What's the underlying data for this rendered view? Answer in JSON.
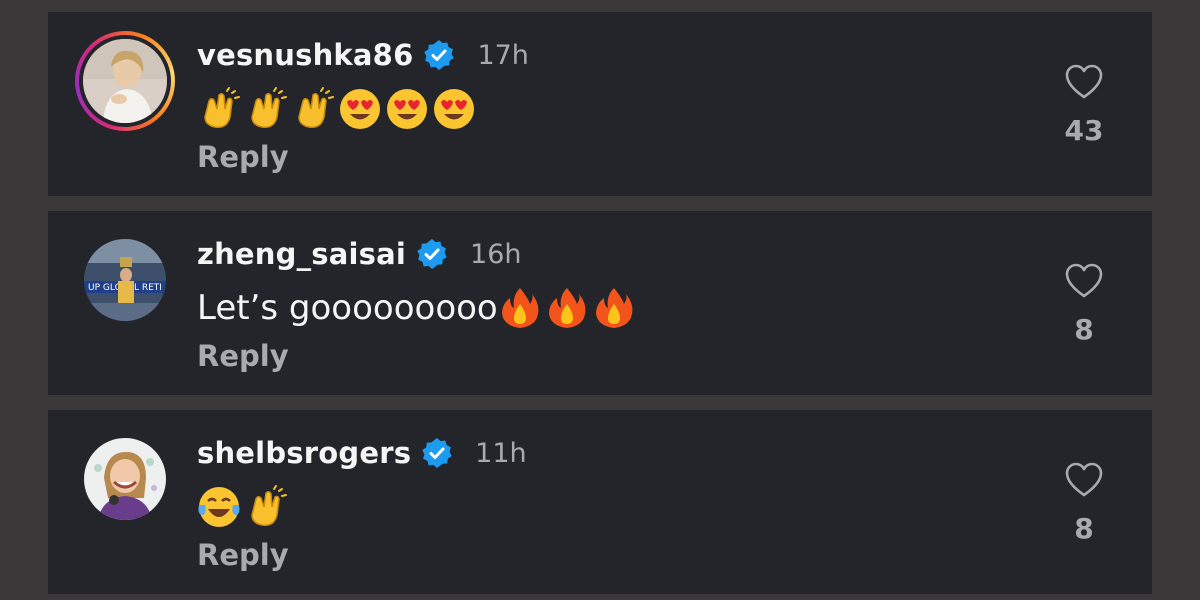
{
  "comments": [
    {
      "username": "vesnushka86",
      "time": "17h",
      "text_suffix": "",
      "emojis": [
        "clap",
        "clap",
        "clap",
        "heart-eyes",
        "heart-eyes",
        "heart-eyes"
      ],
      "reply_label": "Reply",
      "likes": "43",
      "verified": true,
      "has_story_ring": true
    },
    {
      "username": "zheng_saisai",
      "time": "16h",
      "text": "Let’s gooooooooo",
      "emojis": [
        "fire",
        "fire",
        "fire"
      ],
      "reply_label": "Reply",
      "likes": "8",
      "verified": true,
      "has_story_ring": false
    },
    {
      "username": "shelbsrogers",
      "time": "11h",
      "text": "",
      "emojis": [
        "laughing-tears",
        "clap"
      ],
      "reply_label": "Reply",
      "likes": "8",
      "verified": true,
      "has_story_ring": false
    }
  ],
  "colors": {
    "page_background": "#3a3839",
    "card_background": "#23252b",
    "verified_blue": "#1d9bf0",
    "muted_text": "#a8aab0",
    "primary_text": "#f5f5f5"
  }
}
